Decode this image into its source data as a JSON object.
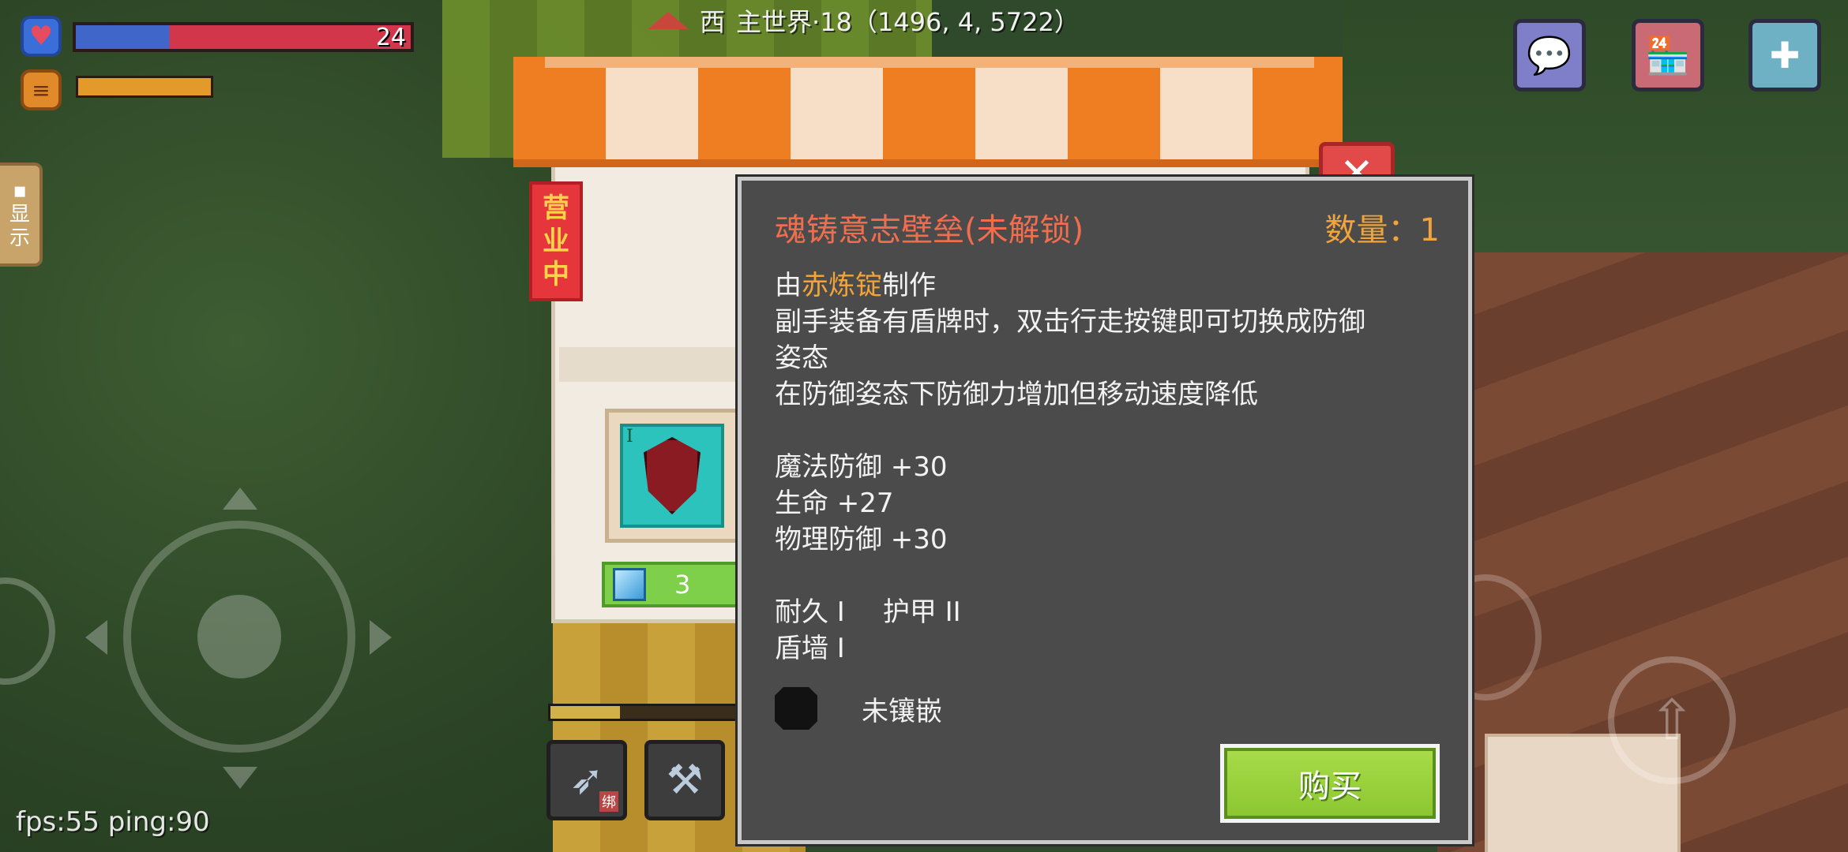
{
  "hud": {
    "health_value": "24",
    "health_fraction": 1.0,
    "hunger_fraction": 1.0,
    "direction": "西",
    "location": "主世界·18（1496, 4, 5722）",
    "side_label_1": "显",
    "side_label_2": "示",
    "fps_text": "fps:55 ping:90"
  },
  "icons": {
    "health": "heart-icon",
    "hunger": "burger-icon",
    "compass": "compass-arrow-icon",
    "chat": "chat-bubble-icon",
    "shop": "shop-icon",
    "plus": "plus-icon",
    "close": "close-icon",
    "jump": "jump-arrow-icon"
  },
  "stall": {
    "open_sign_1": "营",
    "open_sign_2": "业",
    "open_sign_3": "中",
    "item_tier": "I",
    "price": "3"
  },
  "hotbar": {
    "slot1_tag": "绑"
  },
  "tooltip": {
    "title": "魂铸意志壁垒(未解锁)",
    "quantity": "数量：1",
    "made_prefix": "由",
    "made_material": "赤炼锭",
    "made_suffix": "制作",
    "desc_line1": "副手装备有盾牌时，双击行走按键即可切换成防御",
    "desc_line2": "姿态",
    "desc_line3": "在防御姿态下防御力增加但移动速度降低",
    "stat_magic_defense": "魔法防御 +30",
    "stat_life": "生命 +27",
    "stat_physical_defense": "物理防御 +30",
    "enchant_durability": "耐久 I",
    "enchant_armor": "护甲 II",
    "enchant_shieldwall": "盾墙 I",
    "socket_text": "未镶嵌",
    "buy_label": "购买"
  },
  "colors": {
    "title": "#f06d4d",
    "highlight": "#f2a43a",
    "buy_button": "#8ac630",
    "dialog_bg": "#4b4b4b"
  }
}
